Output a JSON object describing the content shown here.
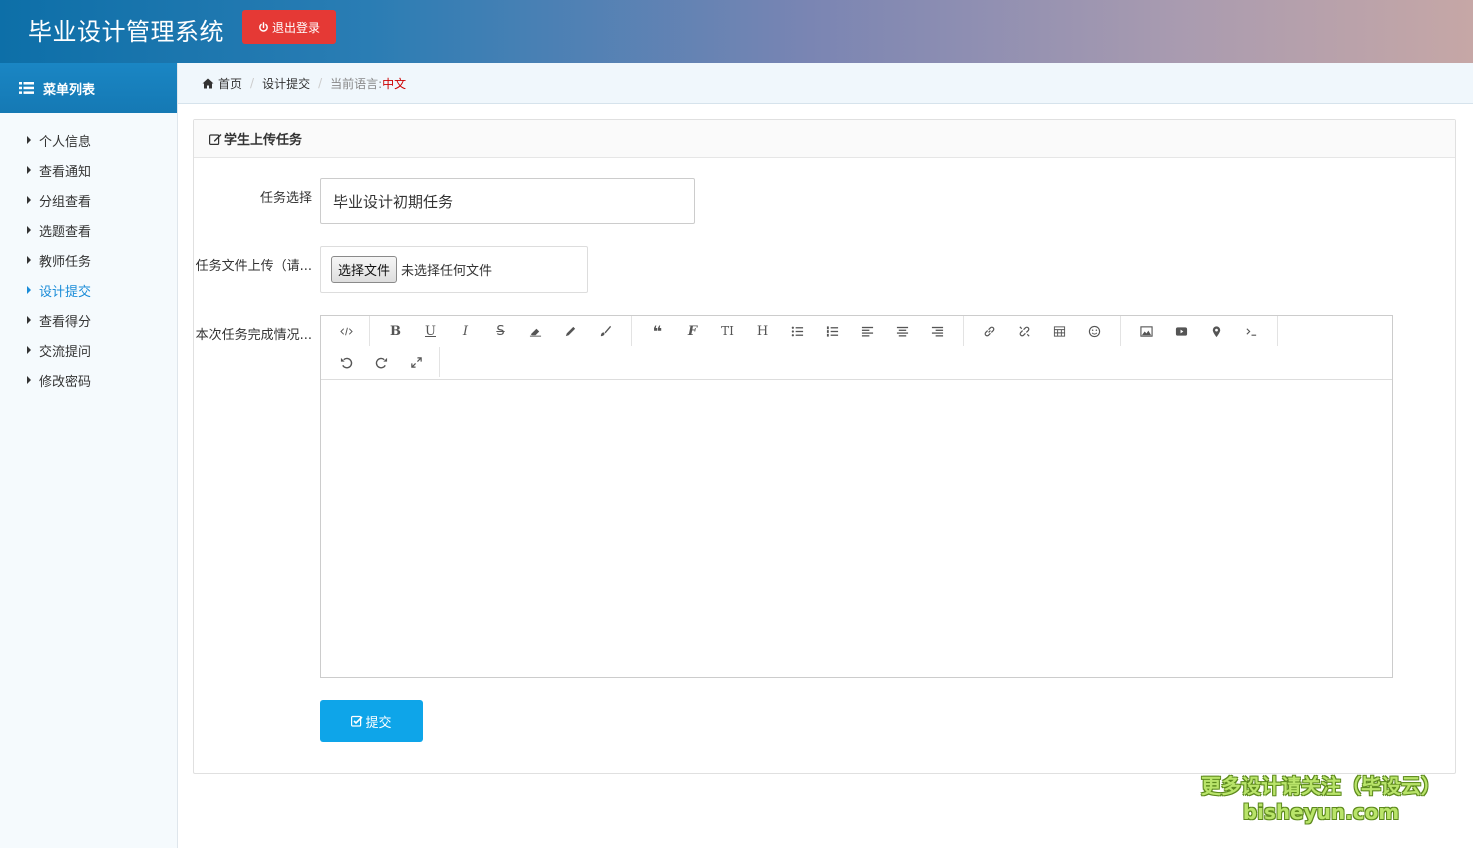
{
  "header": {
    "title": "毕业设计管理系统",
    "logout_label": "退出登录"
  },
  "sidebar": {
    "heading": "菜单列表",
    "items": [
      {
        "label": "个人信息",
        "active": false
      },
      {
        "label": "查看通知",
        "active": false
      },
      {
        "label": "分组查看",
        "active": false
      },
      {
        "label": "选题查看",
        "active": false
      },
      {
        "label": "教师任务",
        "active": false
      },
      {
        "label": "设计提交",
        "active": true
      },
      {
        "label": "查看得分",
        "active": false
      },
      {
        "label": "交流提问",
        "active": false
      },
      {
        "label": "修改密码",
        "active": false
      }
    ]
  },
  "breadcrumb": {
    "home": "首页",
    "current": "设计提交",
    "lang_label": "当前语言:",
    "lang_value": "中文"
  },
  "panel": {
    "title": "学生上传任务",
    "task_label": "任务选择",
    "task_value": "毕业设计初期任务",
    "upload_label": "任务文件上传（请...",
    "file_button": "选择文件",
    "file_status": "未选择任何文件",
    "completion_label": "本次任务完成情况...",
    "submit_label": "提交"
  },
  "editor_toolbar": {
    "row1": [
      [
        "code-view"
      ],
      [
        "bold",
        "underline",
        "italic",
        "strikethrough",
        "eraser",
        "pencil",
        "brush"
      ],
      [
        "blockquote",
        "font",
        "text-height",
        "heading",
        "unordered-list",
        "ordered-list",
        "align-left",
        "align-center",
        "align-right"
      ],
      [
        "link",
        "unlink",
        "table",
        "emoji"
      ],
      [
        "image",
        "video",
        "map-marker",
        "terminal"
      ]
    ],
    "row2": [
      [
        "undo",
        "redo",
        "fullscreen"
      ]
    ]
  },
  "watermark": {
    "line1": "更多设计请关注（毕设云）",
    "line2": "bisheyun.com"
  },
  "colors": {
    "accent": "#1a8cd8",
    "logout": "#e53935",
    "submit": "#0ea5e9"
  }
}
